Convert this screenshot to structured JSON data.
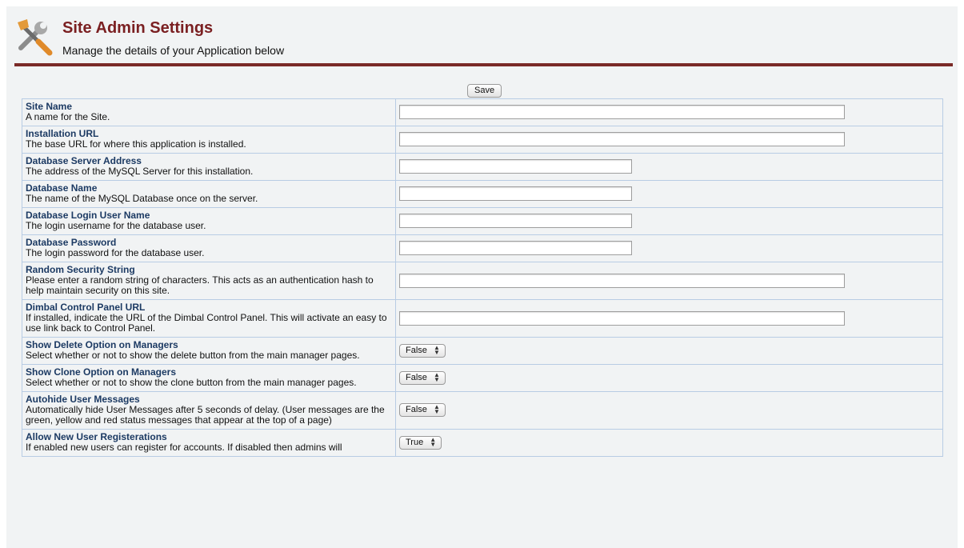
{
  "header": {
    "title": "Site Admin Settings",
    "subtitle": "Manage the details of your Application below",
    "icon": "tools-icon"
  },
  "toolbar": {
    "save_label": "Save"
  },
  "colors": {
    "title": "#7a1f21",
    "rule": "#7a2a27",
    "label": "#1c3a63",
    "border": "#b8cce4",
    "background": "#f1f3f4"
  },
  "settings": [
    {
      "label": "Site Name",
      "description": "A name for the Site.",
      "type": "text",
      "value": ""
    },
    {
      "label": "Installation URL",
      "description": "The base URL for where this application is installed.",
      "type": "text",
      "value": ""
    },
    {
      "label": "Database Server Address",
      "description": "The address of the MySQL Server for this installation.",
      "type": "text",
      "value": ""
    },
    {
      "label": "Database Name",
      "description": "The name of the MySQL Database once on the server.",
      "type": "text",
      "value": ""
    },
    {
      "label": "Database Login User Name",
      "description": "The login username for the database user.",
      "type": "text",
      "value": ""
    },
    {
      "label": "Database Password",
      "description": "The login password for the database user.",
      "type": "text",
      "value": ""
    },
    {
      "label": "Random Security String",
      "description": "Please enter a random string of characters. This acts as an authentication hash to help maintain security on this site.",
      "type": "text",
      "value": ""
    },
    {
      "label": "Dimbal Control Panel URL",
      "description": "If installed, indicate the URL of the Dimbal Control Panel. This will activate an easy to use link back to Control Panel.",
      "type": "text",
      "value": ""
    },
    {
      "label": "Show Delete Option on Managers",
      "description": "Select whether or not to show the delete button from the main manager pages.",
      "type": "select",
      "value": "False"
    },
    {
      "label": "Show Clone Option on Managers",
      "description": "Select whether or not to show the clone button from the main manager pages.",
      "type": "select",
      "value": "False"
    },
    {
      "label": "Autohide User Messages",
      "description": "Automatically hide User Messages after 5 seconds of delay. (User messages are the green, yellow and red status messages that appear at the top of a page)",
      "type": "select",
      "value": "False"
    },
    {
      "label": "Allow New User Registerations",
      "description": "If enabled new users can register for accounts. If disabled then admins will",
      "type": "select",
      "value": "True"
    }
  ]
}
